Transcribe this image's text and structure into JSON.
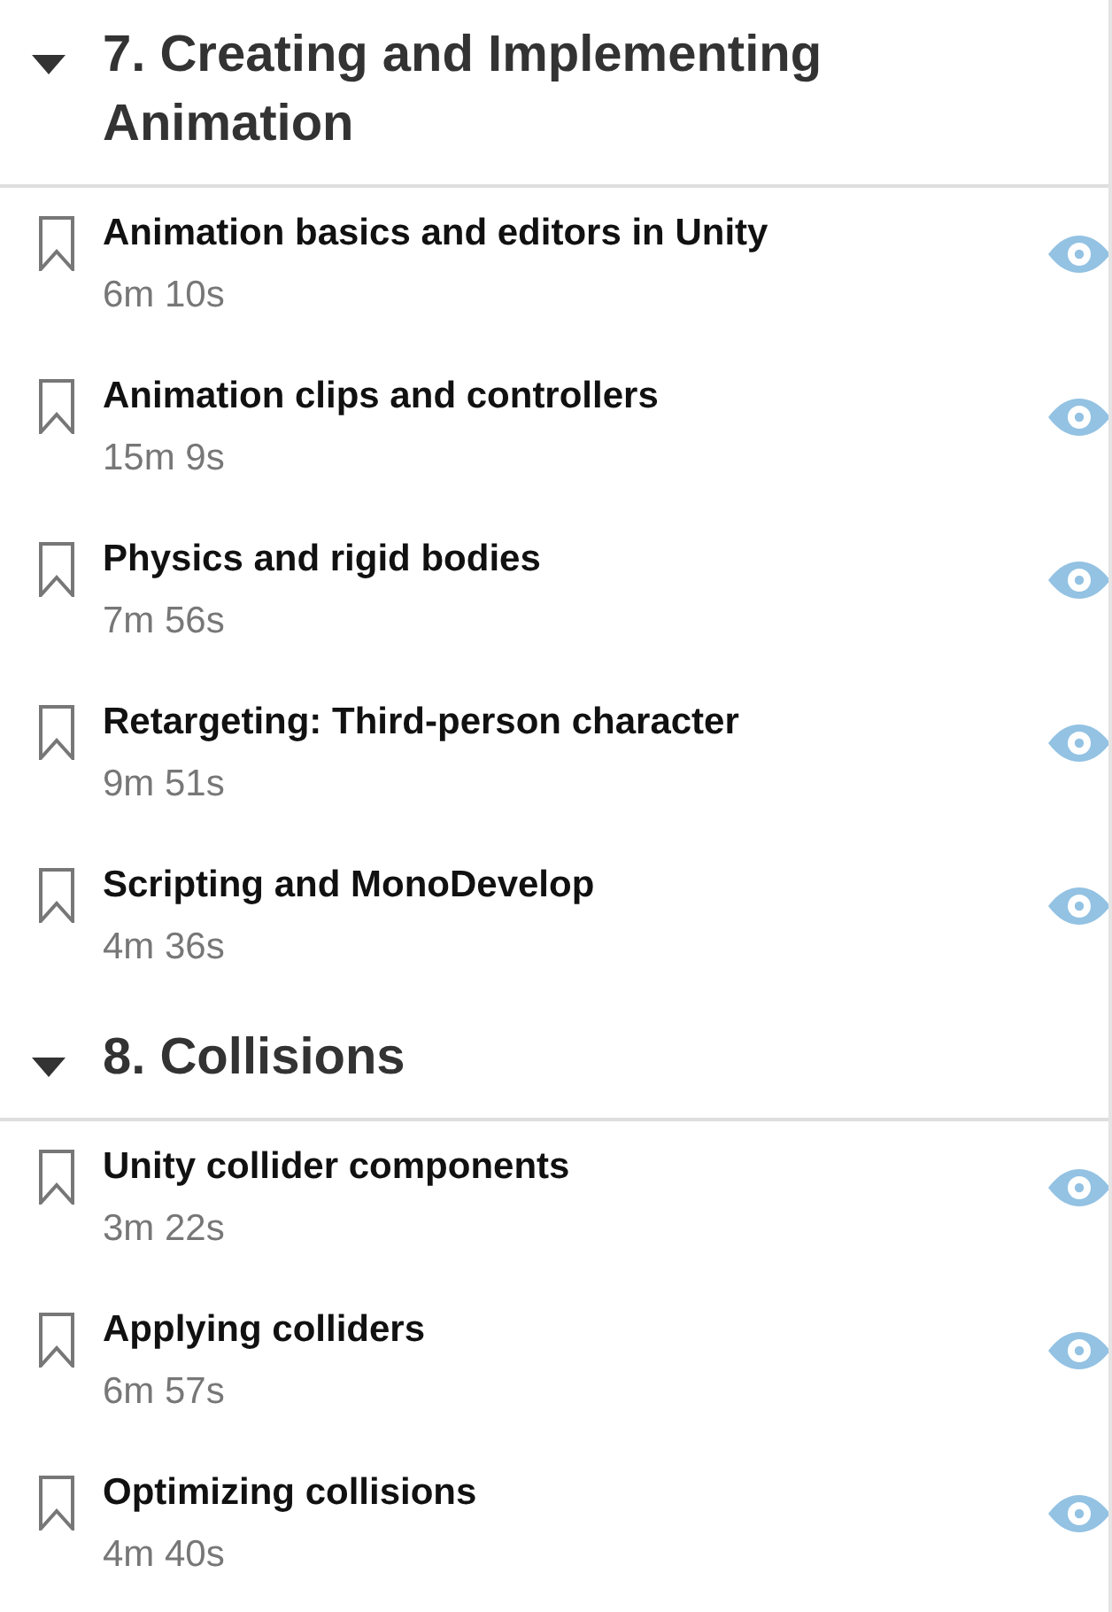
{
  "sections": [
    {
      "title": "7. Creating and Implementing Animation",
      "expanded": true,
      "videos": [
        {
          "title": "Animation basics and editors in Unity",
          "duration": "6m 10s",
          "bookmarked": false
        },
        {
          "title": "Animation clips and controllers",
          "duration": "15m 9s",
          "bookmarked": false
        },
        {
          "title": "Physics and rigid bodies",
          "duration": "7m 56s",
          "bookmarked": false
        },
        {
          "title": "Retargeting: Third-person character",
          "duration": "9m 51s",
          "bookmarked": false
        },
        {
          "title": "Scripting and MonoDevelop",
          "duration": "4m 36s",
          "bookmarked": false
        }
      ]
    },
    {
      "title": "8. Collisions",
      "expanded": true,
      "videos": [
        {
          "title": "Unity collider components",
          "duration": "3m 22s",
          "bookmarked": false
        },
        {
          "title": "Applying colliders",
          "duration": "6m 57s",
          "bookmarked": false
        },
        {
          "title": "Optimizing collisions",
          "duration": "4m 40s",
          "bookmarked": false
        }
      ]
    }
  ]
}
